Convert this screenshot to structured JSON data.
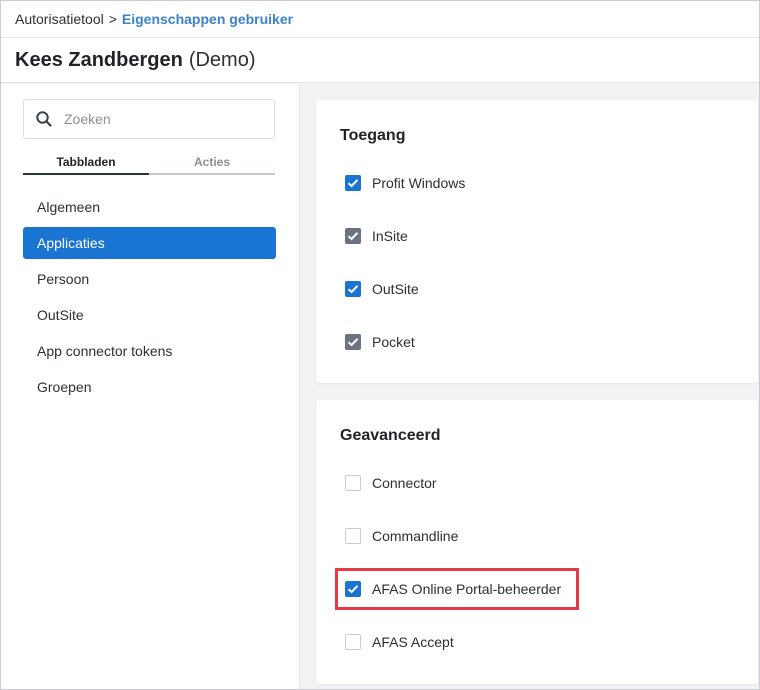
{
  "breadcrumb": {
    "root": "Autorisatietool",
    "separator": ">",
    "current": "Eigenschappen gebruiker"
  },
  "header": {
    "name": "Kees Zandbergen",
    "suffix": "(Demo)"
  },
  "sidebar": {
    "search": {
      "placeholder": "Zoeken",
      "icon": "search-icon"
    },
    "tabs": [
      {
        "label": "Tabbladen",
        "active": true
      },
      {
        "label": "Acties",
        "active": false
      }
    ],
    "items": [
      {
        "label": "Algemeen",
        "active": false
      },
      {
        "label": "Applicaties",
        "active": true
      },
      {
        "label": "Persoon",
        "active": false
      },
      {
        "label": "OutSite",
        "active": false
      },
      {
        "label": "App connector tokens",
        "active": false
      },
      {
        "label": "Groepen",
        "active": false
      }
    ]
  },
  "sections": [
    {
      "title": "Toegang",
      "options": [
        {
          "label": "Profit Windows",
          "checked": true,
          "style": "blue"
        },
        {
          "label": "InSite",
          "checked": true,
          "style": "grey"
        },
        {
          "label": "OutSite",
          "checked": true,
          "style": "blue"
        },
        {
          "label": "Pocket",
          "checked": true,
          "style": "grey"
        }
      ]
    },
    {
      "title": "Geavanceerd",
      "options": [
        {
          "label": "Connector",
          "checked": false,
          "style": "empty"
        },
        {
          "label": "Commandline",
          "checked": false,
          "style": "empty"
        },
        {
          "label": "AFAS Online Portal-beheerder",
          "checked": true,
          "style": "blue"
        },
        {
          "label": "AFAS Accept",
          "checked": false,
          "style": "empty"
        }
      ]
    }
  ],
  "colors": {
    "accent": "#1a74d2",
    "link": "#3b82c9",
    "checkbox_disabled": "#6b7280",
    "highlight": "#e53945"
  }
}
